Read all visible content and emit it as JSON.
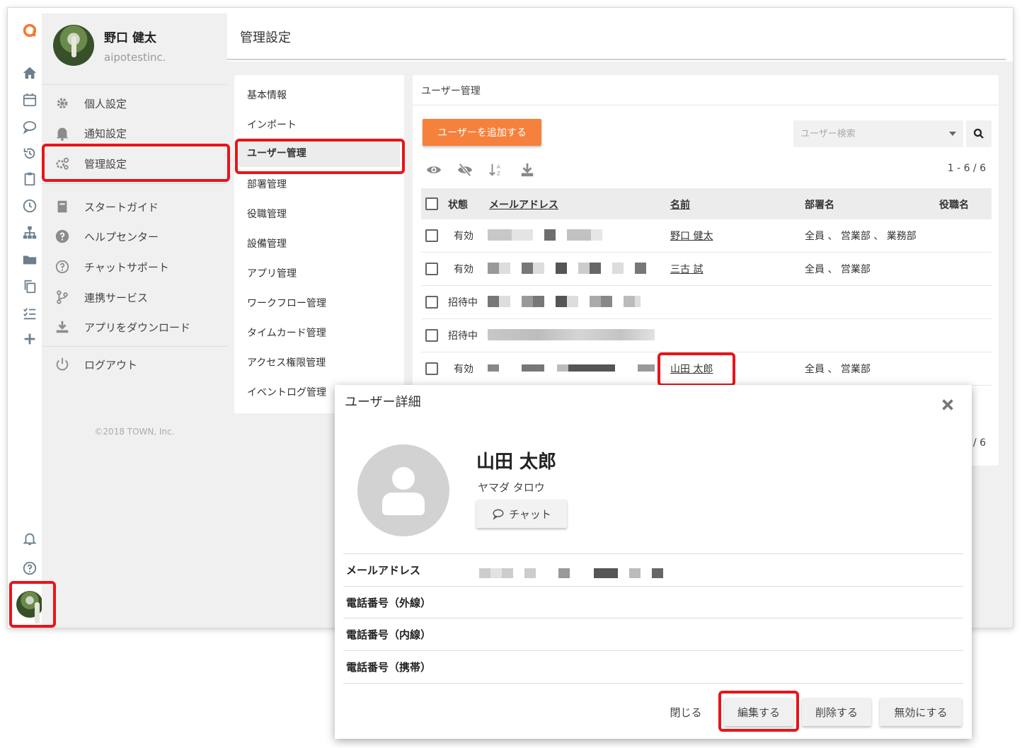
{
  "header": {
    "title": "管理設定"
  },
  "profile": {
    "name": "野口 健太",
    "company": "aipotestinc."
  },
  "side_menu": {
    "items": [
      {
        "label": "個人設定",
        "icon": "gear-icon"
      },
      {
        "label": "通知設定",
        "icon": "bell-icon"
      },
      {
        "label": "管理設定",
        "icon": "gears-icon"
      },
      {
        "label": "スタートガイド",
        "icon": "book-icon"
      },
      {
        "label": "ヘルプセンター",
        "icon": "question-circle-icon"
      },
      {
        "label": "チャットサポート",
        "icon": "question-outline-icon"
      },
      {
        "label": "連携サービス",
        "icon": "branch-icon"
      },
      {
        "label": "アプリをダウンロード",
        "icon": "download-icon"
      }
    ],
    "logout": "ログアウト",
    "copyright": "©2018 TOWN, Inc."
  },
  "settings_nav": {
    "items": [
      "基本情報",
      "インポート",
      "ユーザー管理",
      "部署管理",
      "役職管理",
      "設備管理",
      "アプリ管理",
      "ワークフロー管理",
      "タイムカード管理",
      "アクセス権限管理",
      "イベントログ管理"
    ],
    "active": "ユーザー管理"
  },
  "user_panel": {
    "title": "ユーザー管理",
    "add_button": "ユーザーを追加する",
    "search_placeholder": "ユーザー検索",
    "count": "1 - 6 / 6",
    "columns": {
      "status": "状態",
      "email": "メールアドレス",
      "name": "名前",
      "dept": "部署名",
      "role": "役職名"
    },
    "rows": [
      {
        "status": "有効",
        "name": "野口 健太",
        "dept": "全員 、 営業部 、 業務部"
      },
      {
        "status": "有効",
        "name": "三古 試",
        "dept": "全員 、 営業部"
      },
      {
        "status": "招待中",
        "name": "",
        "dept": ""
      },
      {
        "status": "招待中",
        "name": "",
        "dept": ""
      },
      {
        "status": "有効",
        "name": "山田 太郎",
        "dept": "全員 、 営業部"
      }
    ],
    "count_partial": "/ 6"
  },
  "modal": {
    "title": "ユーザー詳細",
    "name": "山田 太郎",
    "kana": "ヤマダ タロウ",
    "chat_button": "チャット",
    "fields": {
      "email": "メールアドレス",
      "phone_ext": "電話番号（外線）",
      "phone_int": "電話番号（内線）",
      "phone_mobile": "電話番号（携帯）"
    },
    "buttons": {
      "close": "閉じる",
      "edit": "編集する",
      "delete": "削除する",
      "disable": "無効にする"
    }
  },
  "colors": {
    "accent": "#f5813c",
    "highlight": "#e8141b",
    "logo": "#f47a30"
  }
}
